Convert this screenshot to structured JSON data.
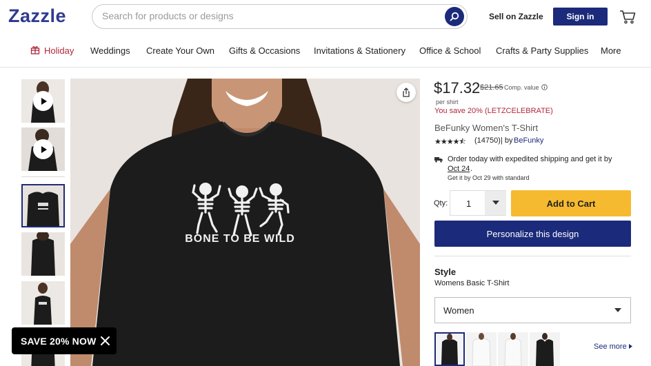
{
  "header": {
    "logo": "Zazzle",
    "search_placeholder": "Search for products or designs",
    "sell_label": "Sell on Zazzle",
    "signin_label": "Sign in"
  },
  "nav": {
    "items": [
      "Holiday",
      "Weddings",
      "Create Your Own",
      "Gifts & Occasions",
      "Invitations & Stationery",
      "Office & School",
      "Crafts & Party Supplies",
      "More"
    ]
  },
  "design": {
    "print_text": "BONE TO BE WILD"
  },
  "product": {
    "price": "$17.32",
    "comp_price": "$21.65",
    "comp_label": "Comp. value",
    "per_unit": "per shirt",
    "savings": "You save 20% (LETZCELEBRATE)",
    "title": "BeFunky Women's T-Shirt",
    "rating_stars": "★★★★⯪",
    "review_count": "(14750)",
    "by_label": "| by",
    "brand": "BeFunky"
  },
  "shipping": {
    "line1": "Order today with expedited shipping and get it by",
    "date": "Oct 24",
    "period": ".",
    "line3": "Get it by Oct 29 with standard"
  },
  "purchase": {
    "qty_label": "Qty:",
    "qty_value": "1",
    "add_to_cart": "Add to Cart",
    "personalize": "Personalize this design"
  },
  "style": {
    "heading": "Style",
    "value": "Womens Basic T-Shirt",
    "selected_option": "Women",
    "see_more": "See more"
  },
  "promo": {
    "label": "SAVE 20% NOW"
  },
  "colors": {
    "brand_navy": "#1b2a7a",
    "holiday_red": "#b0273c",
    "cart_yellow": "#f6ba30",
    "shirt_black": "#1c1c1c"
  },
  "icons": [
    "search-icon",
    "cart-icon",
    "gift-icon",
    "play-icon",
    "share-icon",
    "info-icon",
    "truck-icon",
    "chevron-down-icon",
    "close-icon"
  ]
}
